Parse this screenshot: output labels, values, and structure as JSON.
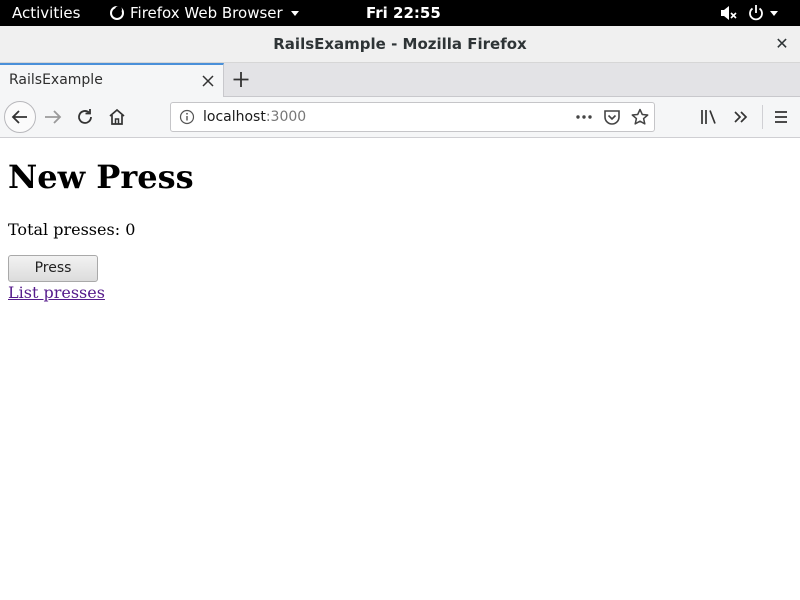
{
  "system_bar": {
    "activities": "Activities",
    "app_name": "Firefox Web Browser",
    "clock": "Fri 22:55"
  },
  "window": {
    "title": "RailsExample - Mozilla Firefox"
  },
  "tabs": [
    {
      "label": "RailsExample",
      "active": true
    }
  ],
  "url": {
    "host": "localhost",
    "port": ":3000"
  },
  "page": {
    "heading": "New Press",
    "total_label": "Total presses:",
    "total_value": "0",
    "press_button": "Press",
    "list_link": "List presses"
  },
  "icons": [
    "firefox-icon",
    "volume-muted-icon",
    "power-icon",
    "close-icon",
    "plus-icon",
    "back-arrow-icon",
    "forward-arrow-icon",
    "reload-icon",
    "home-icon",
    "info-icon",
    "more-dots-icon",
    "pocket-icon",
    "star-icon",
    "library-icon",
    "overflow-chevron-icon",
    "hamburger-menu-icon"
  ],
  "colors": {
    "tab_accent": "#4a90d9",
    "visited_link": "#551a8b"
  }
}
